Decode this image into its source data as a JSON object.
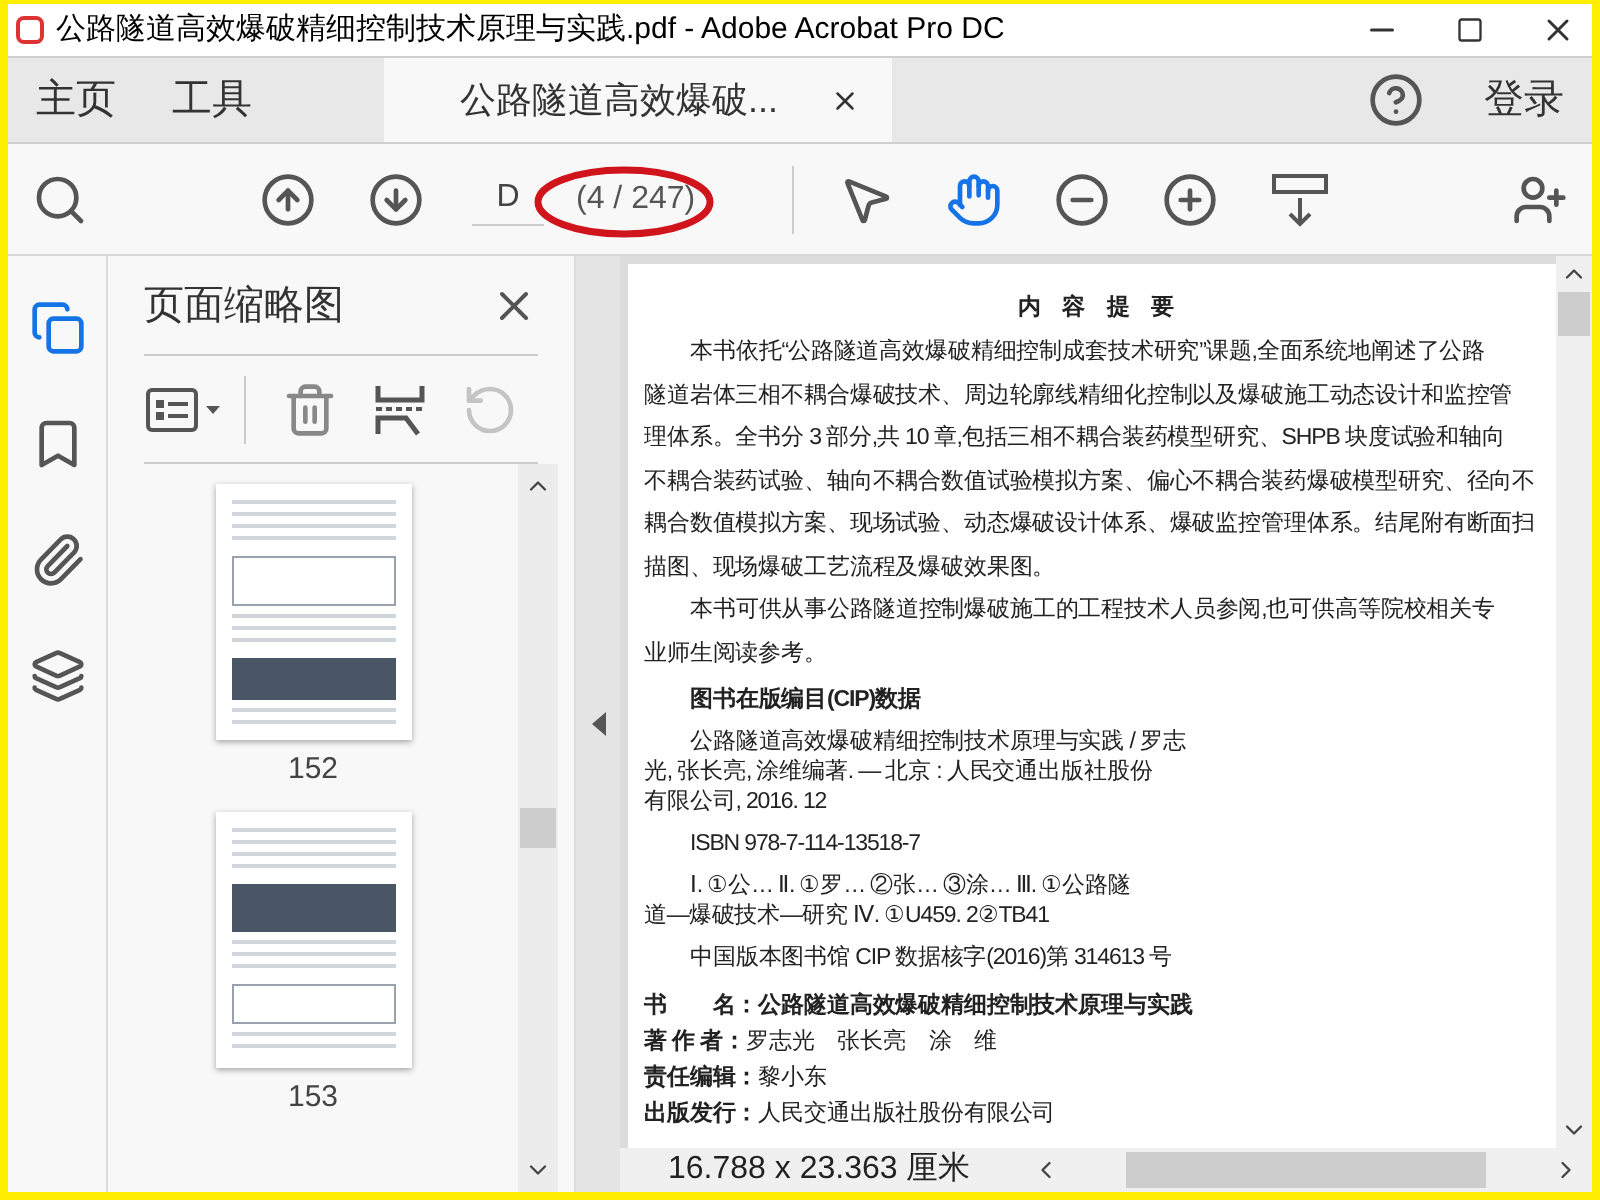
{
  "window": {
    "title": "公路隧道高效爆破精细控制技术原理与实践.pdf - Adobe Acrobat Pro DC"
  },
  "tabs": [
    {
      "label": "主页",
      "kind": "nav",
      "selected": false
    },
    {
      "label": "工具",
      "kind": "nav",
      "selected": false
    },
    {
      "label": "公路隧道高效爆破...",
      "kind": "document",
      "selected": true
    }
  ],
  "sign_in": "登录",
  "toolbar": {
    "page_field": {
      "value": "D"
    },
    "page_count": "(4 / 247)",
    "annotated": true,
    "tools": [
      {
        "kind": "select",
        "selected": false
      },
      {
        "kind": "hand",
        "selected": true
      }
    ]
  },
  "rail": [
    {
      "kind": "pages",
      "selected": true
    },
    {
      "kind": "bookmarks",
      "selected": false
    },
    {
      "kind": "attachments",
      "selected": false
    },
    {
      "kind": "layers",
      "selected": false
    }
  ],
  "thumbnails_panel": {
    "title": "页面缩略图",
    "rotate_disabled": true,
    "thumbnails": [
      {
        "label": "152",
        "kind": "table"
      },
      {
        "label": "153",
        "kind": "chart"
      }
    ]
  },
  "document": {
    "lines": [
      {
        "kind": "title",
        "text": "内 容 提 要"
      },
      {
        "kind": "indent",
        "text": "本书依托“公路隧道高效爆破精细控制成套技术研究”课题,全面系统地阐述了公路"
      },
      {
        "kind": "plain",
        "text": "隧道岩体三相不耦合爆破技术、周边轮廓线精细化控制以及爆破施工动态设计和监控管"
      },
      {
        "kind": "plain",
        "text": "理体系。全书分 3 部分,共 10 章,包括三相不耦合装药模型研究、SHPB 块度试验和轴向"
      },
      {
        "kind": "plain",
        "text": "不耦合装药试验、轴向不耦合数值试验模拟方案、偏心不耦合装药爆破模型研究、径向不"
      },
      {
        "kind": "plain",
        "text": "耦合数值模拟方案、现场试验、动态爆破设计体系、爆破监控管理体系。结尾附有断面扫"
      },
      {
        "kind": "plain",
        "text": "描图、现场爆破工艺流程及爆破效果图。"
      },
      {
        "kind": "indent",
        "text": "本书可供从事公路隧道控制爆破施工的工程技术人员参阅,也可供高等院校相关专"
      },
      {
        "kind": "plain",
        "text": "业师生阅读参考。"
      },
      {
        "kind": "heading",
        "text": "图书在版编目(CIP)数据"
      },
      {
        "kind": "cip_indent",
        "text": "公路隧道高效爆破精细控制技术原理与实践 / 罗志"
      },
      {
        "kind": "cip",
        "text": "光, 张长亮, 涂维编著. — 北京 : 人民交通出版社股份"
      },
      {
        "kind": "cip",
        "text": "有限公司, 2016. 12"
      },
      {
        "kind": "cip_indent",
        "text": "ISBN  978-7-114-13518-7"
      },
      {
        "kind": "cip_gap",
        "text": "Ⅰ. ①公…  Ⅱ. ①罗… ②张… ③涂…  Ⅲ. ①公路隧"
      },
      {
        "kind": "cip",
        "text": "道—爆破技术—研究  Ⅳ. ①U459. 2②TB41"
      },
      {
        "kind": "cip_gap",
        "text": "中国版本图书馆 CIP 数据核字(2016)第 314613 号"
      },
      {
        "kind": "info_first",
        "text": "**书　　名：公路隧道高效爆破精细控制技术原理与实践**"
      },
      {
        "kind": "info",
        "text": "**著 作 者：**罗志光　张长亮　涂　维"
      },
      {
        "kind": "info",
        "text": "**责任编辑：**黎小东"
      },
      {
        "kind": "info",
        "text": "**出版发行：**人民交通出版社股份有限公司"
      }
    ]
  },
  "status_bar": {
    "page_size": "16.788 x 23.363 厘米"
  }
}
